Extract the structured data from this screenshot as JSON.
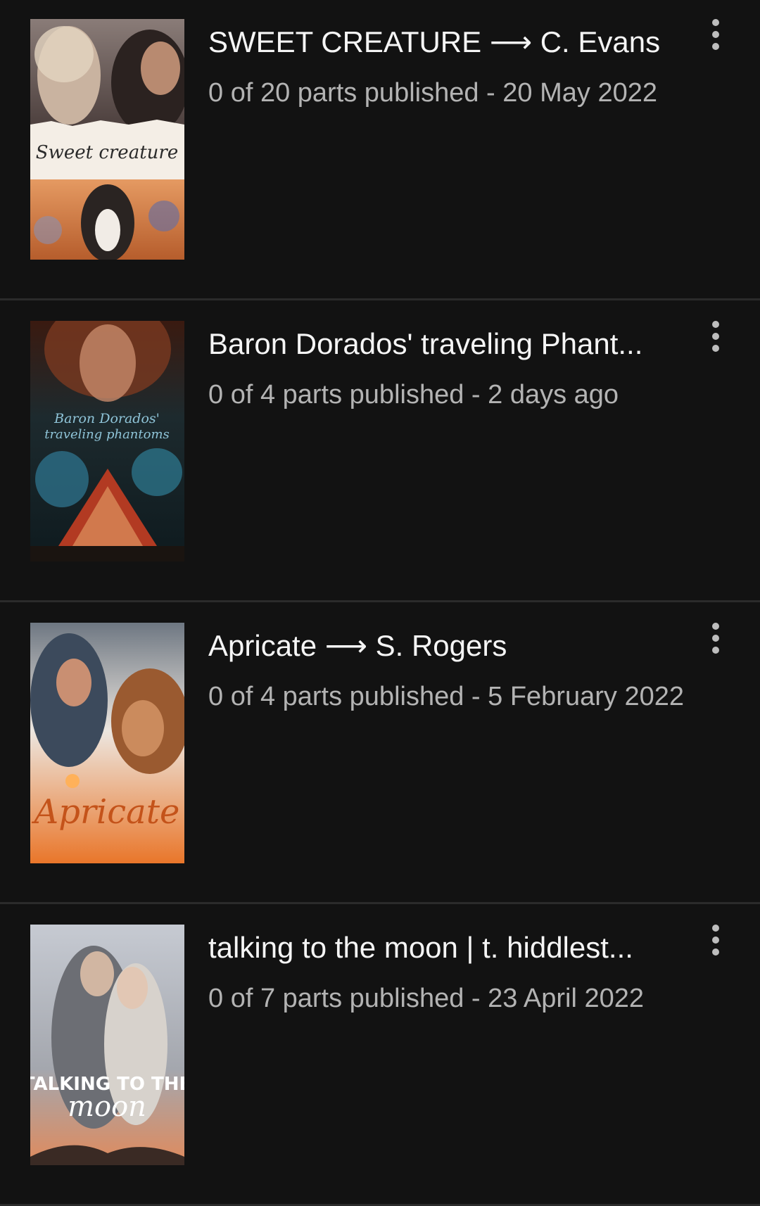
{
  "stories": [
    {
      "title": "SWEET CREATURE ⟶ C. Evans",
      "parts_published": "0 of 20 parts published",
      "separator": " - ",
      "date": "20 May 2022",
      "cover_icon": "cover-image",
      "cover_text": "Sweet creature",
      "cover_colors": {
        "top": "#6b5a55",
        "band": "#f4eee6",
        "bottom": "#d9824a",
        "text": "#2a2a2a"
      }
    },
    {
      "title": "Baron Dorados' traveling Phant...",
      "parts_published": "0 of 4 parts published",
      "separator": " - ",
      "date": "2 days ago",
      "cover_icon": "cover-image",
      "cover_text": "Baron Dorados' traveling phantoms",
      "cover_colors": {
        "top": "#5a2a1a",
        "band": "#0f2a35",
        "bottom": "#1c3a44",
        "text": "#8fc4d8"
      }
    },
    {
      "title": "Apricate ⟶ S. Rogers",
      "parts_published": "0 of 4 parts published",
      "separator": " - ",
      "date": "5 February 2022",
      "cover_icon": "cover-image",
      "cover_text": "Apricate",
      "cover_colors": {
        "top": "#5d6b78",
        "band": "#e9e3dc",
        "bottom": "#e7772b",
        "text": "#c4531a"
      }
    },
    {
      "title": "talking to the moon | t. hiddlest...",
      "parts_published": "0 of 7 parts published",
      "separator": " - ",
      "date": "23 April 2022",
      "cover_icon": "cover-image",
      "cover_text": "TALKING TO THE moon",
      "cover_colors": {
        "top": "#bfc4cc",
        "band": "#9b9ea6",
        "bottom": "#e08a5c",
        "text": "#ffffff"
      }
    }
  ],
  "more_icon": "more-vertical-icon"
}
